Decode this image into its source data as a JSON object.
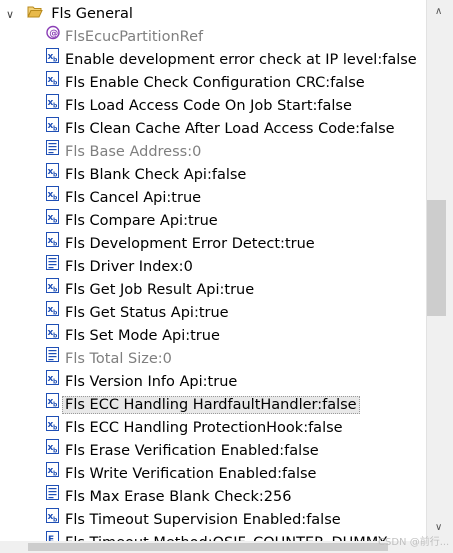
{
  "tree": {
    "root": {
      "label": "Fls General",
      "expanded": true
    },
    "items": [
      {
        "label": "FlsEcucPartitionRef",
        "icon": "reference-icon",
        "disabled": true,
        "selected": false
      },
      {
        "label": "Enable development error check at IP level:false",
        "icon": "boolean-param-icon",
        "disabled": false,
        "selected": false
      },
      {
        "label": "Fls Enable Check Configuration CRC:false",
        "icon": "boolean-param-icon",
        "disabled": false,
        "selected": false
      },
      {
        "label": "Fls Load Access Code On Job Start:false",
        "icon": "boolean-param-icon",
        "disabled": false,
        "selected": false
      },
      {
        "label": "Fls Clean Cache After Load Access Code:false",
        "icon": "boolean-param-icon",
        "disabled": false,
        "selected": false
      },
      {
        "label": "Fls Base Address:0",
        "icon": "integer-param-icon",
        "disabled": true,
        "selected": false
      },
      {
        "label": "Fls Blank Check Api:false",
        "icon": "boolean-param-icon",
        "disabled": false,
        "selected": false
      },
      {
        "label": "Fls Cancel Api:true",
        "icon": "boolean-param-icon",
        "disabled": false,
        "selected": false
      },
      {
        "label": "Fls Compare Api:true",
        "icon": "boolean-param-icon",
        "disabled": false,
        "selected": false
      },
      {
        "label": "Fls Development Error Detect:true",
        "icon": "boolean-param-icon",
        "disabled": false,
        "selected": false
      },
      {
        "label": "Fls Driver Index:0",
        "icon": "integer-param-icon",
        "disabled": false,
        "selected": false
      },
      {
        "label": "Fls Get Job Result Api:true",
        "icon": "boolean-param-icon",
        "disabled": false,
        "selected": false
      },
      {
        "label": "Fls Get Status Api:true",
        "icon": "boolean-param-icon",
        "disabled": false,
        "selected": false
      },
      {
        "label": "Fls Set Mode Api:true",
        "icon": "boolean-param-icon",
        "disabled": false,
        "selected": false
      },
      {
        "label": "Fls Total Size:0",
        "icon": "integer-param-icon",
        "disabled": true,
        "selected": false
      },
      {
        "label": "Fls Version Info Api:true",
        "icon": "boolean-param-icon",
        "disabled": false,
        "selected": false
      },
      {
        "label": "Fls ECC Handling HardfaultHandler:false",
        "icon": "boolean-param-icon",
        "disabled": false,
        "selected": true
      },
      {
        "label": "Fls ECC Handling ProtectionHook:false",
        "icon": "boolean-param-icon",
        "disabled": false,
        "selected": false
      },
      {
        "label": "Fls Erase Verification Enabled:false",
        "icon": "boolean-param-icon",
        "disabled": false,
        "selected": false
      },
      {
        "label": "Fls Write Verification Enabled:false",
        "icon": "boolean-param-icon",
        "disabled": false,
        "selected": false
      },
      {
        "label": "Fls Max Erase Blank Check:256",
        "icon": "integer-param-icon",
        "disabled": false,
        "selected": false
      },
      {
        "label": "Fls Timeout Supervision Enabled:false",
        "icon": "boolean-param-icon",
        "disabled": false,
        "selected": false
      },
      {
        "label": "Fls Timeout Method:OSIF_COUNTER_DUMMY",
        "icon": "enum-param-icon",
        "disabled": false,
        "selected": false
      }
    ]
  },
  "colors": {
    "selection": "#e8e8e8",
    "disabled_text": "#7f7f7f",
    "icon_blue": "#1f4fb5",
    "folder": "#e8b94a"
  },
  "watermark": "CSDN @前行..."
}
